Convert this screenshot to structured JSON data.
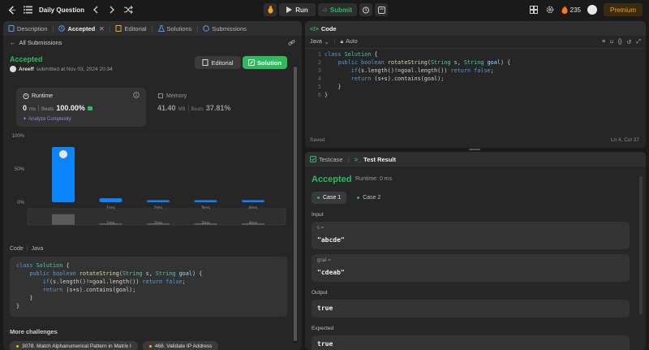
{
  "topbar": {
    "title": "Daily Question",
    "run_label": "Run",
    "submit_label": "Submit",
    "streak_count": "235",
    "premium_label": "Premium"
  },
  "left_tabs": [
    {
      "label": "Description",
      "icon": "document-icon"
    },
    {
      "label": "Accepted",
      "icon": "clock-icon"
    },
    {
      "label": "Editorial",
      "icon": "book-icon"
    },
    {
      "label": "Solutions",
      "icon": "flask-icon"
    },
    {
      "label": "Submissions",
      "icon": "history-icon"
    }
  ],
  "submission": {
    "back_label": "All Submissions",
    "status": "Accepted",
    "author": "Areeff",
    "submitted_text": "submitted at Nov 03, 2024 20:34",
    "editorial_btn": "Editorial",
    "solution_btn": "Solution"
  },
  "runtime": {
    "title": "Runtime",
    "value": "0",
    "unit": "ms",
    "beats_label": "Beats",
    "beats_value": "100.00%",
    "analyze_label": "Analyze Complexity"
  },
  "memory": {
    "title": "Memory",
    "value": "41.40",
    "unit": "MB",
    "beats_label": "Beats",
    "beats_value": "37.81%"
  },
  "chart_data": {
    "type": "bar",
    "categories": [
      "0ms",
      "1ms",
      "2ms",
      "3ms",
      "4ms"
    ],
    "values": [
      83,
      6,
      3,
      3,
      3
    ],
    "ylim": [
      0,
      100
    ],
    "ytick_labels": [
      "100%",
      "50%",
      "0%"
    ],
    "xtick_labels": [
      "",
      "1ms",
      "2ms",
      "3ms",
      "4ms"
    ],
    "grid": true,
    "colors": {
      "bar": "#0a84ff",
      "mini_bar": "#5a5a5a"
    }
  },
  "left_code": {
    "label": "Code",
    "language": "Java",
    "lines": [
      "class Solution {",
      "    public boolean rotateString(String s, String goal) {",
      "        if(s.length()!=goal.length()) return false;",
      "        return (s+s).contains(goal);",
      "    }",
      "}"
    ]
  },
  "more_challenges": {
    "title": "More challenges",
    "items": [
      "3078. Match Alphanumerical Pattern in Matrix I",
      "468. Validate IP Address"
    ]
  },
  "code_panel": {
    "title": "Code",
    "language": "Java",
    "mode": "Auto",
    "line_numbers": [
      "1",
      "2",
      "3",
      "4",
      "5",
      "6"
    ],
    "saved_label": "Saved",
    "cursor_pos": "Ln 4, Col 37"
  },
  "test_panel": {
    "tab_testcase": "Testcase",
    "tab_result": "Test Result",
    "status": "Accepted",
    "runtime_text": "Runtime: 0 ms",
    "cases": [
      "Case 1",
      "Case 2"
    ],
    "input_label": "Input",
    "inputs": [
      {
        "name": "s =",
        "value": "\"abcde\""
      },
      {
        "name": "goal =",
        "value": "\"cdeab\""
      }
    ],
    "output_label": "Output",
    "output_value": "true",
    "expected_label": "Expected",
    "expected_value": "true"
  },
  "colors": {
    "accent_green": "#2cbb5d",
    "bar_blue": "#0a84ff",
    "premium": "#ffa116",
    "purple_link": "#9a84e6"
  }
}
